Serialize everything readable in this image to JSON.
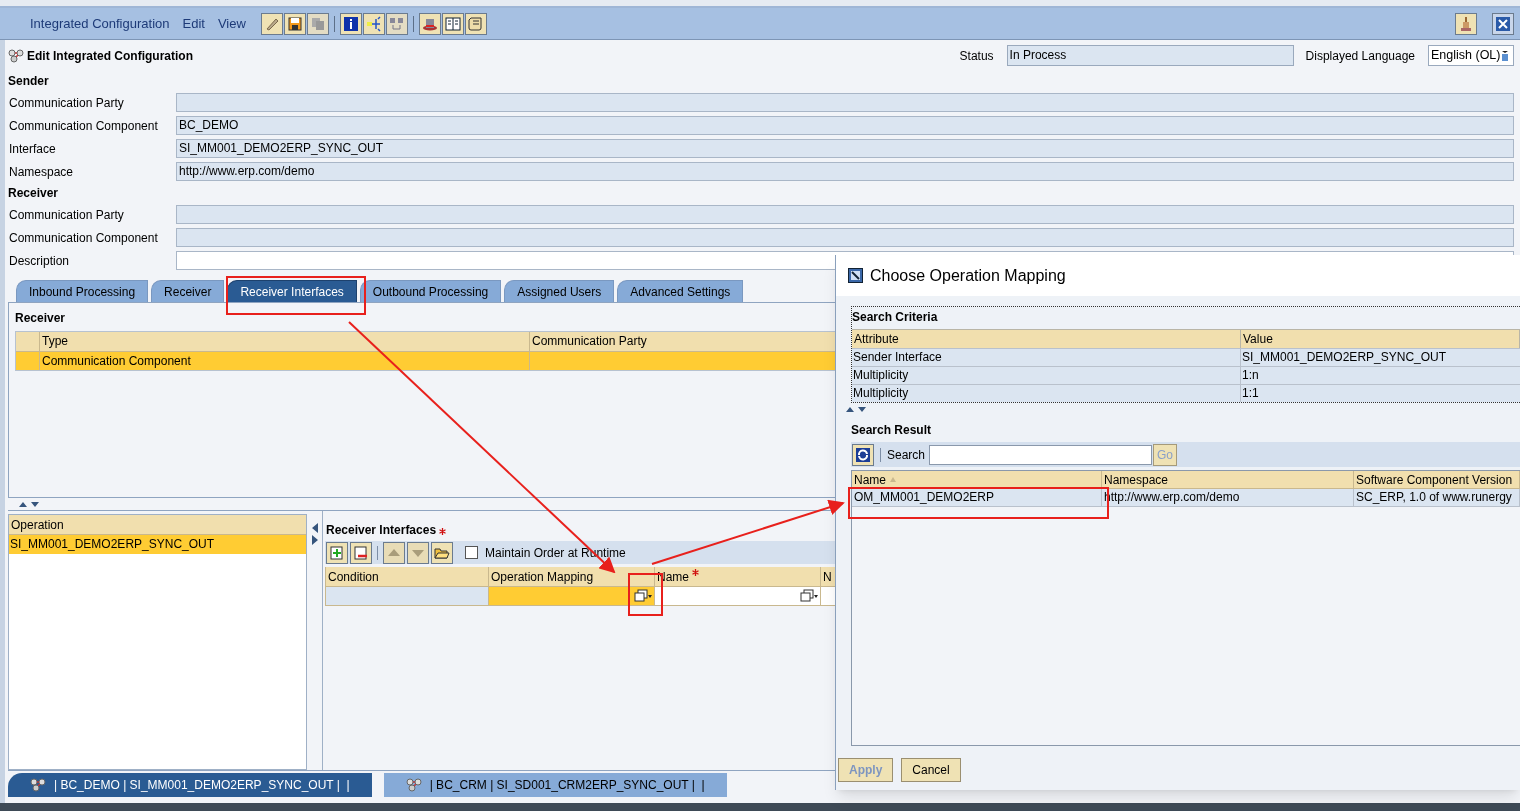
{
  "menu": [
    "Integrated Configuration",
    "Edit",
    "View"
  ],
  "page_title": "Edit Integrated Configuration",
  "status": {
    "label": "Status",
    "value": "In Process"
  },
  "language": {
    "label": "Displayed Language",
    "value": "English (OL)"
  },
  "sections": [
    {
      "heading": "Sender",
      "fields": [
        {
          "label": "Communication Party",
          "editable": false
        },
        {
          "label": "Communication Component",
          "value": "BC_DEMO",
          "editable": false
        },
        {
          "label": "Interface",
          "value": "SI_MM001_DEMO2ERP_SYNC_OUT",
          "editable": false
        },
        {
          "label": "Namespace",
          "value": "http://www.erp.com/demo",
          "editable": false
        }
      ]
    },
    {
      "heading": "Receiver",
      "fields": [
        {
          "label": "Communication Party",
          "editable": false
        },
        {
          "label": "Communication Component",
          "editable": false
        },
        {
          "label": "Description",
          "editable": true
        }
      ]
    }
  ],
  "tabs": [
    {
      "label": "Inbound Processing",
      "selected": false
    },
    {
      "label": "Receiver",
      "selected": false
    },
    {
      "label": "Receiver Interfaces",
      "selected": true
    },
    {
      "label": "Outbound Processing",
      "selected": false
    },
    {
      "label": "Assigned Users",
      "selected": false
    },
    {
      "label": "Advanced Settings",
      "selected": false
    }
  ],
  "receiver_table": {
    "heading": "Receiver",
    "columns": [
      "Type",
      "Communication Party"
    ],
    "rows": [
      {
        "type": "Communication Component",
        "selected": true
      }
    ]
  },
  "operations": {
    "column": "Operation",
    "rows": [
      {
        "label": "SI_MM001_DEMO2ERP_SYNC_OUT",
        "selected": true
      }
    ]
  },
  "receiver_interfaces": {
    "heading": "Receiver Interfaces",
    "required": true,
    "maintain_order": {
      "label": "Maintain Order at Runtime",
      "checked": false
    },
    "columns": [
      {
        "label": "Condition",
        "required": false
      },
      {
        "label": "Operation Mapping",
        "required": false
      },
      {
        "label": "Name",
        "required": true
      },
      {
        "label": "N",
        "required": false
      }
    ]
  },
  "bottom_tabs": [
    {
      "label": "| BC_DEMO | SI_MM001_DEMO2ERP_SYNC_OUT |  |",
      "selected": true
    },
    {
      "label": "| BC_CRM | SI_SD001_CRM2ERP_SYNC_OUT |  |",
      "selected": false
    }
  ],
  "dialog": {
    "title": "Choose Operation Mapping",
    "criteria": {
      "heading": "Search Criteria",
      "columns": [
        "Attribute",
        "Value"
      ],
      "rows": [
        {
          "attribute": "Sender Interface",
          "value": "SI_MM001_DEMO2ERP_SYNC_OUT"
        },
        {
          "attribute": "Multiplicity",
          "value": "1:n"
        },
        {
          "attribute": "Multiplicity",
          "value": "1:1"
        }
      ]
    },
    "result": {
      "heading": "Search Result",
      "search_label": "Search",
      "go": "Go",
      "columns": [
        {
          "label": "Name",
          "sorted": true
        },
        {
          "label": "Namespace",
          "sorted": false
        },
        {
          "label": "Software Component Version",
          "sorted": false
        }
      ],
      "rows": [
        {
          "cells": [
            "OM_MM001_DEMO2ERP",
            "http://www.erp.com/demo",
            "SC_ERP, 1.0 of www.runergy"
          ]
        }
      ]
    },
    "buttons": [
      {
        "label": "Apply",
        "disabled": true
      },
      {
        "label": "Cancel",
        "disabled": false
      }
    ]
  }
}
